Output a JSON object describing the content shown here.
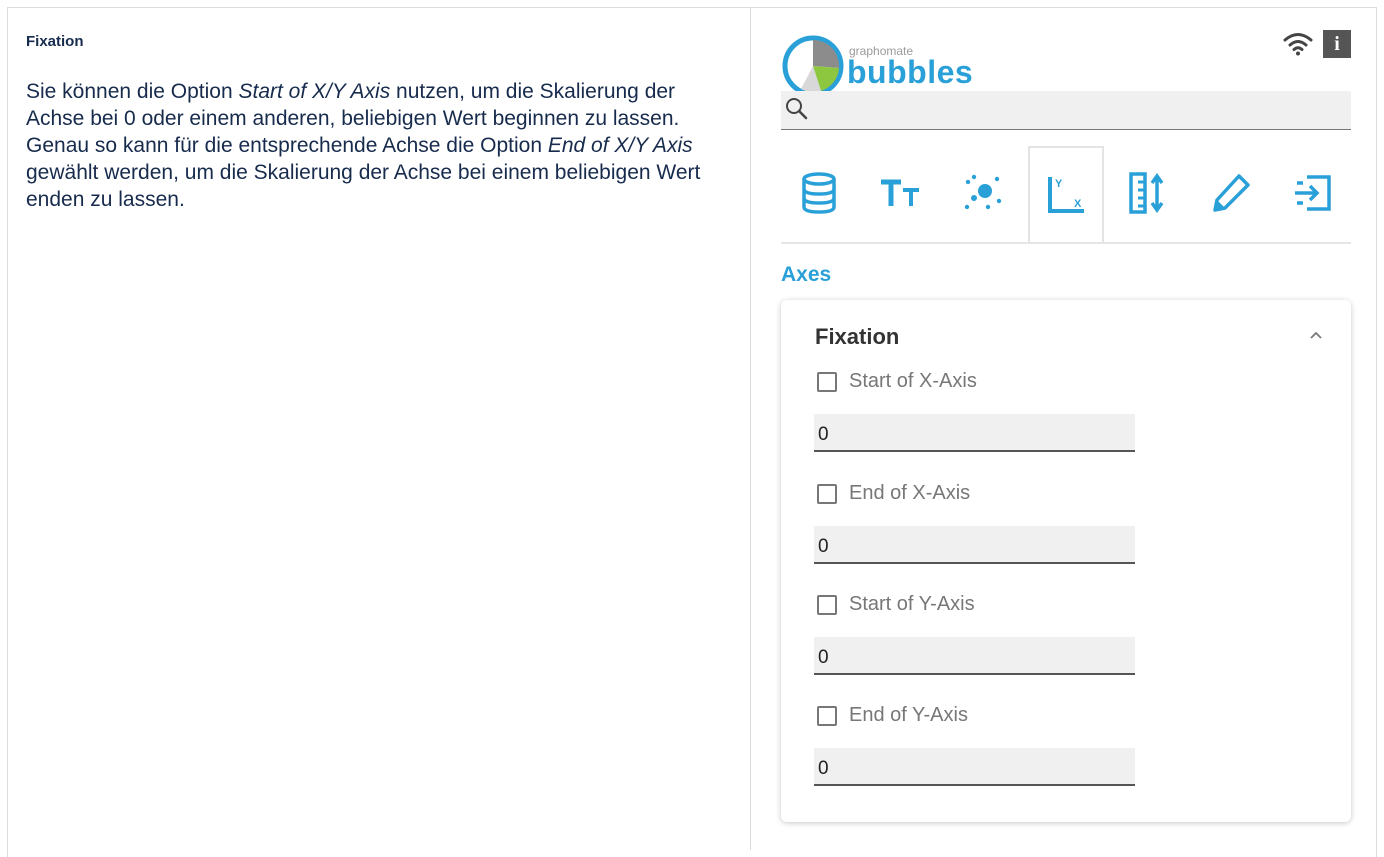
{
  "doc": {
    "heading": "Fixation",
    "paragraph": {
      "t1": "Sie können die Option ",
      "em1": "Start of X/Y Axis",
      "t2": " nutzen, um die Skalierung der Achse bei 0 oder einem anderen, beliebigen Wert beginnen zu lassen. Genau so kann für die entsprechende Achse die Option ",
      "em2": "End of X/Y Axis",
      "t3": " gewählt werden, um die Skalierung der Achse bei einem beliebigen Wert enden zu lassen."
    }
  },
  "panel": {
    "brand_small": "graphomate",
    "brand_name": "bubbles",
    "info_label": "i",
    "search": {
      "value": "",
      "placeholder": ""
    },
    "tabs": [
      {
        "icon": "database-icon"
      },
      {
        "icon": "text-size-icon"
      },
      {
        "icon": "bubbles-icon"
      },
      {
        "icon": "axes-icon",
        "active": true
      },
      {
        "icon": "ruler-icon"
      },
      {
        "icon": "pencil-icon"
      },
      {
        "icon": "export-icon"
      }
    ],
    "section_title": "Axes",
    "card": {
      "title": "Fixation",
      "options": [
        {
          "label": "Start of X-Axis",
          "checked": false,
          "value": "0"
        },
        {
          "label": "End of X-Axis",
          "checked": false,
          "value": "0"
        },
        {
          "label": "Start of Y-Axis",
          "checked": false,
          "value": "0"
        },
        {
          "label": "End of Y-Axis",
          "checked": false,
          "value": "0"
        }
      ]
    },
    "colors": {
      "accent": "#2aa0d8",
      "logo_grey": "#8c8c8c",
      "logo_green": "#8dc63f"
    }
  }
}
